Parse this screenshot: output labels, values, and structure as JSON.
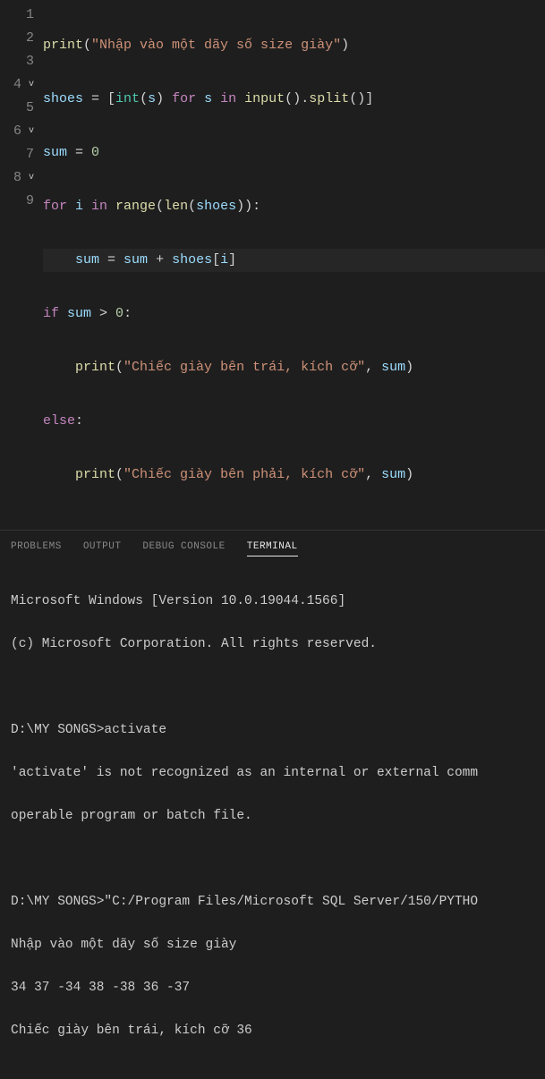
{
  "editor": {
    "lines": [
      {
        "num": "1",
        "fold": ""
      },
      {
        "num": "2",
        "fold": ""
      },
      {
        "num": "3",
        "fold": ""
      },
      {
        "num": "4",
        "fold": "v"
      },
      {
        "num": "5",
        "fold": ""
      },
      {
        "num": "6",
        "fold": "v"
      },
      {
        "num": "7",
        "fold": ""
      },
      {
        "num": "8",
        "fold": "v"
      },
      {
        "num": "9",
        "fold": ""
      }
    ],
    "tokens": {
      "l1": {
        "print": "print",
        "lp": "(",
        "str": "\"Nhập vào một dãy số size giày\"",
        "rp": ")"
      },
      "l2": {
        "shoes": "shoes",
        "eq": " = ",
        "lb": "[",
        "int": "int",
        "lp": "(",
        "s": "s",
        "rp": ")",
        "for": " for ",
        "s2": "s",
        "in": " in ",
        "input": "input",
        "lp2": "(",
        "rp2": ")",
        "dot": ".",
        "split": "split",
        "lp3": "(",
        "rp3": ")",
        "rb": "]"
      },
      "l3": {
        "sum": "sum",
        "eq": " = ",
        "zero": "0"
      },
      "l4": {
        "for": "for ",
        "i": "i",
        "in": " in ",
        "range": "range",
        "lp": "(",
        "len": "len",
        "lp2": "(",
        "shoes": "shoes",
        "rp2": ")",
        "rp": ")",
        "colon": ":"
      },
      "l5": {
        "sum": "sum",
        "eq": " = ",
        "sum2": "sum",
        "plus": " + ",
        "shoes": "shoes",
        "lb": "[",
        "i": "i",
        "rb": "]"
      },
      "l6": {
        "if": "if ",
        "sum": "sum",
        "gt": " > ",
        "zero": "0",
        "colon": ":"
      },
      "l7": {
        "print": "print",
        "lp": "(",
        "str": "\"Chiếc giày bên trái, kích cỡ\"",
        "comma": ", ",
        "sum": "sum",
        "rp": ")"
      },
      "l8": {
        "else": "else",
        "colon": ":"
      },
      "l9": {
        "print": "print",
        "lp": "(",
        "str": "\"Chiếc giày bên phải, kích cỡ\"",
        "comma": ", ",
        "sum": "sum",
        "rp": ")"
      }
    }
  },
  "panel": {
    "tabs": {
      "problems": "PROBLEMS",
      "output": "OUTPUT",
      "debug": "DEBUG CONSOLE",
      "terminal": "TERMINAL"
    },
    "terminal": {
      "l1": "Microsoft Windows [Version 10.0.19044.1566]",
      "l2": "(c) Microsoft Corporation. All rights reserved.",
      "l3": "",
      "l4": "D:\\MY SONGS>activate",
      "l5": "'activate' is not recognized as an internal or external comm",
      "l6": "operable program or batch file.",
      "l7": "",
      "l8": "D:\\MY SONGS>\"C:/Program Files/Microsoft SQL Server/150/PYTHO",
      "l9": "Nhập vào một dãy số size giày",
      "l10": "34 37 -34 38 -38 36 -37",
      "l11": "Chiếc giày bên trái, kích cỡ 36"
    }
  }
}
